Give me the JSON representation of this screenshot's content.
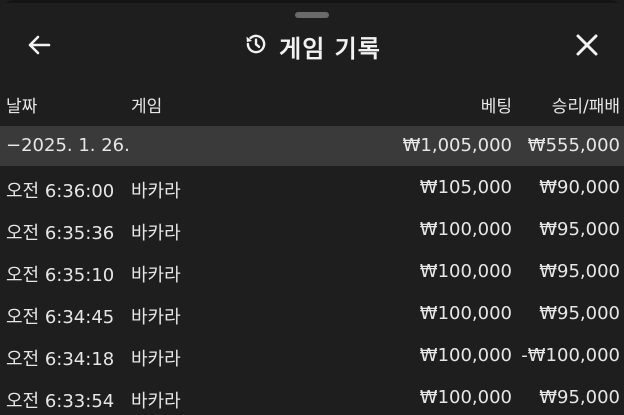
{
  "header": {
    "title": "게임 기록",
    "icons": {
      "back": "arrow-left-icon",
      "history": "history-icon",
      "close": "close-icon"
    }
  },
  "columns": {
    "date": "날짜",
    "game": "게임",
    "bet": "베팅",
    "result": "승리/패배"
  },
  "summary": {
    "date": "−2025. 1. 26.",
    "bet": "₩1,005,000",
    "result": "₩555,000"
  },
  "rows": [
    {
      "time": "오전 6:36:00",
      "game": "바카라",
      "bet": "₩105,000",
      "result": "₩90,000"
    },
    {
      "time": "오전 6:35:36",
      "game": "바카라",
      "bet": "₩100,000",
      "result": "₩95,000"
    },
    {
      "time": "오전 6:35:10",
      "game": "바카라",
      "bet": "₩100,000",
      "result": "₩95,000"
    },
    {
      "time": "오전 6:34:45",
      "game": "바카라",
      "bet": "₩100,000",
      "result": "₩95,000"
    },
    {
      "time": "오전 6:34:18",
      "game": "바카라",
      "bet": "₩100,000",
      "result": "-₩100,000"
    },
    {
      "time": "오전 6:33:54",
      "game": "바카라",
      "bet": "₩100,000",
      "result": "₩95,000"
    }
  ]
}
